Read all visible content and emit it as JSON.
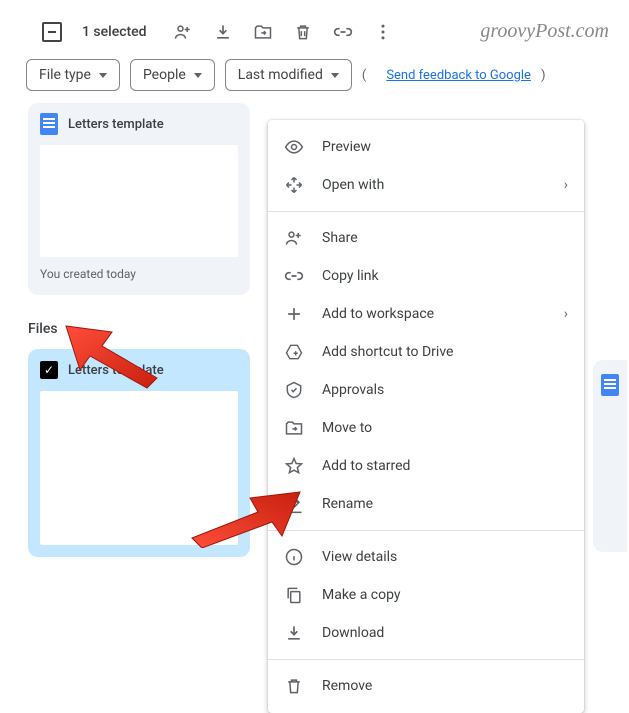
{
  "toolbar": {
    "selectedText": "1 selected",
    "watermark": "groovyPost.com"
  },
  "filters": {
    "fileType": "File type",
    "people": "People",
    "lastModified": "Last modified",
    "feedback": "Send feedback to Google"
  },
  "suggested": {
    "title": "Letters template",
    "footer": "You created today"
  },
  "sections": {
    "filesLabel": "Files"
  },
  "file": {
    "title": "Letters template"
  },
  "menu": {
    "items": [
      {
        "label": "Preview"
      },
      {
        "label": "Open with",
        "hasSubmenu": true
      },
      {
        "sep": true
      },
      {
        "label": "Share"
      },
      {
        "label": "Copy link"
      },
      {
        "label": "Add to workspace",
        "hasSubmenu": true
      },
      {
        "label": "Add shortcut to Drive"
      },
      {
        "label": "Approvals"
      },
      {
        "label": "Move to"
      },
      {
        "label": "Add to starred"
      },
      {
        "label": "Rename"
      },
      {
        "sep": true
      },
      {
        "label": "View details"
      },
      {
        "label": "Make a copy"
      },
      {
        "label": "Download"
      },
      {
        "sep": true
      },
      {
        "label": "Remove"
      }
    ]
  }
}
